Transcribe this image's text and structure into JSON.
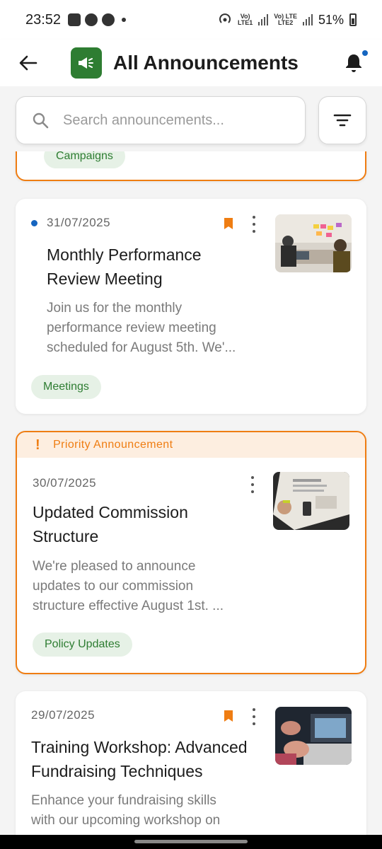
{
  "status_bar": {
    "time": "23:52",
    "net1_top": "Vo)",
    "net1_bottom": "LTE1",
    "net2_top": "Vo) LTE",
    "net2_bottom": "LTE2",
    "battery": "51%"
  },
  "app_bar": {
    "title": "All Announcements"
  },
  "search": {
    "placeholder": "Search announcements..."
  },
  "cards": [
    {
      "tag": "Campaigns"
    },
    {
      "date": "31/07/2025",
      "title": "Monthly Performance Review Meeting",
      "title_line1": "Monthly Performance",
      "title_line2": "Review Meeting",
      "body_line1": "Join us for the monthly",
      "body_line2": "performance review meeting",
      "body_line3": "scheduled for August 5th. We'...",
      "tag": "Meetings",
      "unread": true,
      "bookmarked": true
    },
    {
      "priority_label": "Priority Announcement",
      "date": "30/07/2025",
      "title_line1": "Updated Commission",
      "title_line2": "Structure",
      "body_line1": "We're pleased to announce",
      "body_line2": "updates to our commission",
      "body_line3": "structure effective August 1st. ...",
      "tag": "Policy Updates",
      "priority": true
    },
    {
      "date": "29/07/2025",
      "title_line1": "Training Workshop: Advanced",
      "title_line2": "Fundraising Techniques",
      "body_line1": "Enhance your fundraising skills",
      "body_line2": "with our upcoming workshop on",
      "bookmarked": true
    }
  ],
  "colors": {
    "brand_green": "#2e7d32",
    "priority_orange": "#ef7d12",
    "unread_blue": "#1565c0",
    "tag_bg": "#e6f1e6"
  }
}
